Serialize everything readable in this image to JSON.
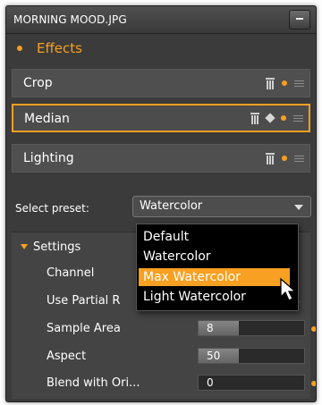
{
  "window": {
    "title": "MORNING MOOD.JPG",
    "minimize_label": "minimize"
  },
  "effects": {
    "header": "Effects",
    "items": [
      {
        "name": "Crop"
      },
      {
        "name": "Median",
        "selected": true
      },
      {
        "name": "Lighting"
      }
    ]
  },
  "preset": {
    "label": "Select preset:",
    "value": "Watercolor",
    "options": [
      "Default",
      "Watercolor",
      "Max Watercolor",
      "Light Watercolor"
    ],
    "highlighted": "Max Watercolor"
  },
  "settings": {
    "header": "Settings",
    "channel_label": "Channel",
    "use_partial_label": "Use Partial R",
    "use_partial_checked": true,
    "sample_area": {
      "label": "Sample Area",
      "value": "8",
      "level": 0.38
    },
    "aspect": {
      "label": "Aspect",
      "value": "50",
      "level": 0.38
    },
    "blend": {
      "label": "Blend with Ori...",
      "value": "0",
      "level": 0.0
    }
  },
  "colors": {
    "accent": "#f7a021",
    "panel": "#3b3b3b",
    "row": "#4f4f4f"
  }
}
